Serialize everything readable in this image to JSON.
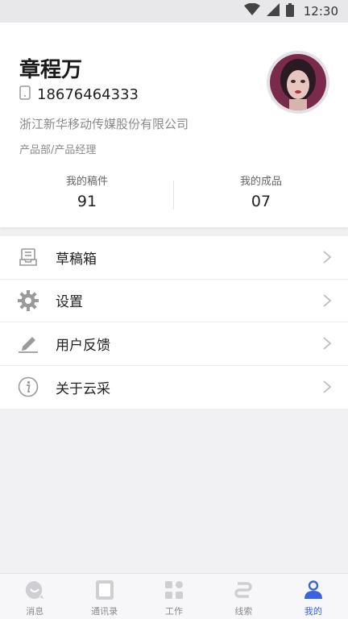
{
  "status_bar": {
    "time": "12:30"
  },
  "profile": {
    "name": "章程万",
    "phone": "18676464333",
    "company": "浙江新华移动传媒股份有限公司",
    "department": "产品部/产品经理",
    "stats": [
      {
        "label": "我的稿件",
        "value": "91"
      },
      {
        "label": "我的成品",
        "value": "07"
      }
    ]
  },
  "menu": {
    "items": [
      {
        "label": "草稿箱",
        "icon": "inbox-icon"
      },
      {
        "label": "设置",
        "icon": "gear-icon"
      },
      {
        "label": "用户反馈",
        "icon": "pencil-icon"
      },
      {
        "label": "关于云采",
        "icon": "info-icon"
      }
    ]
  },
  "tabbar": {
    "tabs": [
      {
        "label": "消息",
        "icon": "message-icon",
        "active": false
      },
      {
        "label": "通讯录",
        "icon": "contacts-icon",
        "active": false
      },
      {
        "label": "工作",
        "icon": "grid-icon",
        "active": false
      },
      {
        "label": "线索",
        "icon": "route-icon",
        "active": false
      },
      {
        "label": "我的",
        "icon": "user-icon",
        "active": true
      }
    ]
  },
  "colors": {
    "accent": "#3a63e0",
    "background": "#f1f1f3",
    "status_bar": "#e8e8ea"
  }
}
